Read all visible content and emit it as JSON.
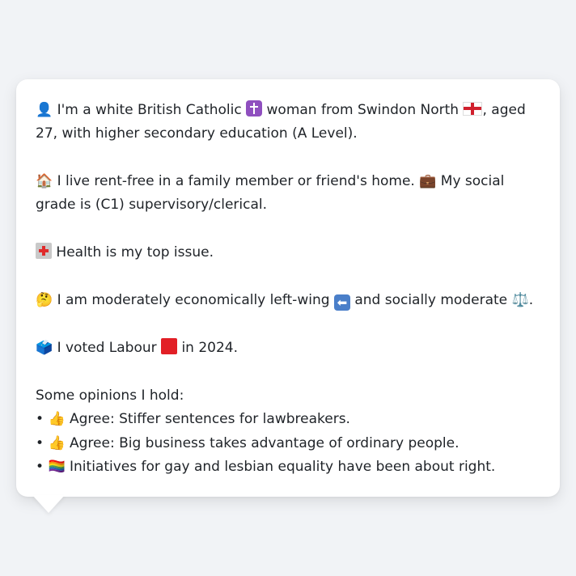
{
  "bubble": {
    "p1": {
      "icon_1": "👤",
      "text_1": "I'm a white British Catholic",
      "icon_2": "latin-cross",
      "text_2": "woman from Swindon North",
      "icon_3": "england-flag",
      "text_3": ", aged 27, with higher secondary education (A Level)."
    },
    "p2": {
      "icon_1": "🏠",
      "text_1": "I live rent-free in a family member or friend's home.",
      "icon_2": "💼",
      "text_2": "My social grade is (C1) supervisory/clerical."
    },
    "p3": {
      "icon_1": "hospital",
      "text_1": "Health is my top issue."
    },
    "p4": {
      "icon_1": "🤔",
      "text_1": "I am moderately economically left-wing",
      "icon_2": "⬅",
      "text_2": "and socially moderate",
      "icon_3": "⚖️",
      "text_3": "."
    },
    "p5": {
      "icon_1": "🗳️",
      "text_1": "I voted Labour",
      "icon_2": "red-square",
      "text_2": "in 2024."
    },
    "opinions": {
      "heading": "Some opinions I hold:",
      "bullet": "•",
      "items": [
        {
          "icon": "👍",
          "text": "Agree: Stiffer sentences for lawbreakers."
        },
        {
          "icon": "👍",
          "text": "Agree: Big business takes advantage of ordinary people."
        },
        {
          "icon": "🏳️‍🌈",
          "text": "Initiatives for gay and lesbian equality have been about right."
        }
      ]
    }
  },
  "colors": {
    "background": "#f1f3f6",
    "bubble": "#ffffff",
    "labour_red": "#e21f26"
  }
}
